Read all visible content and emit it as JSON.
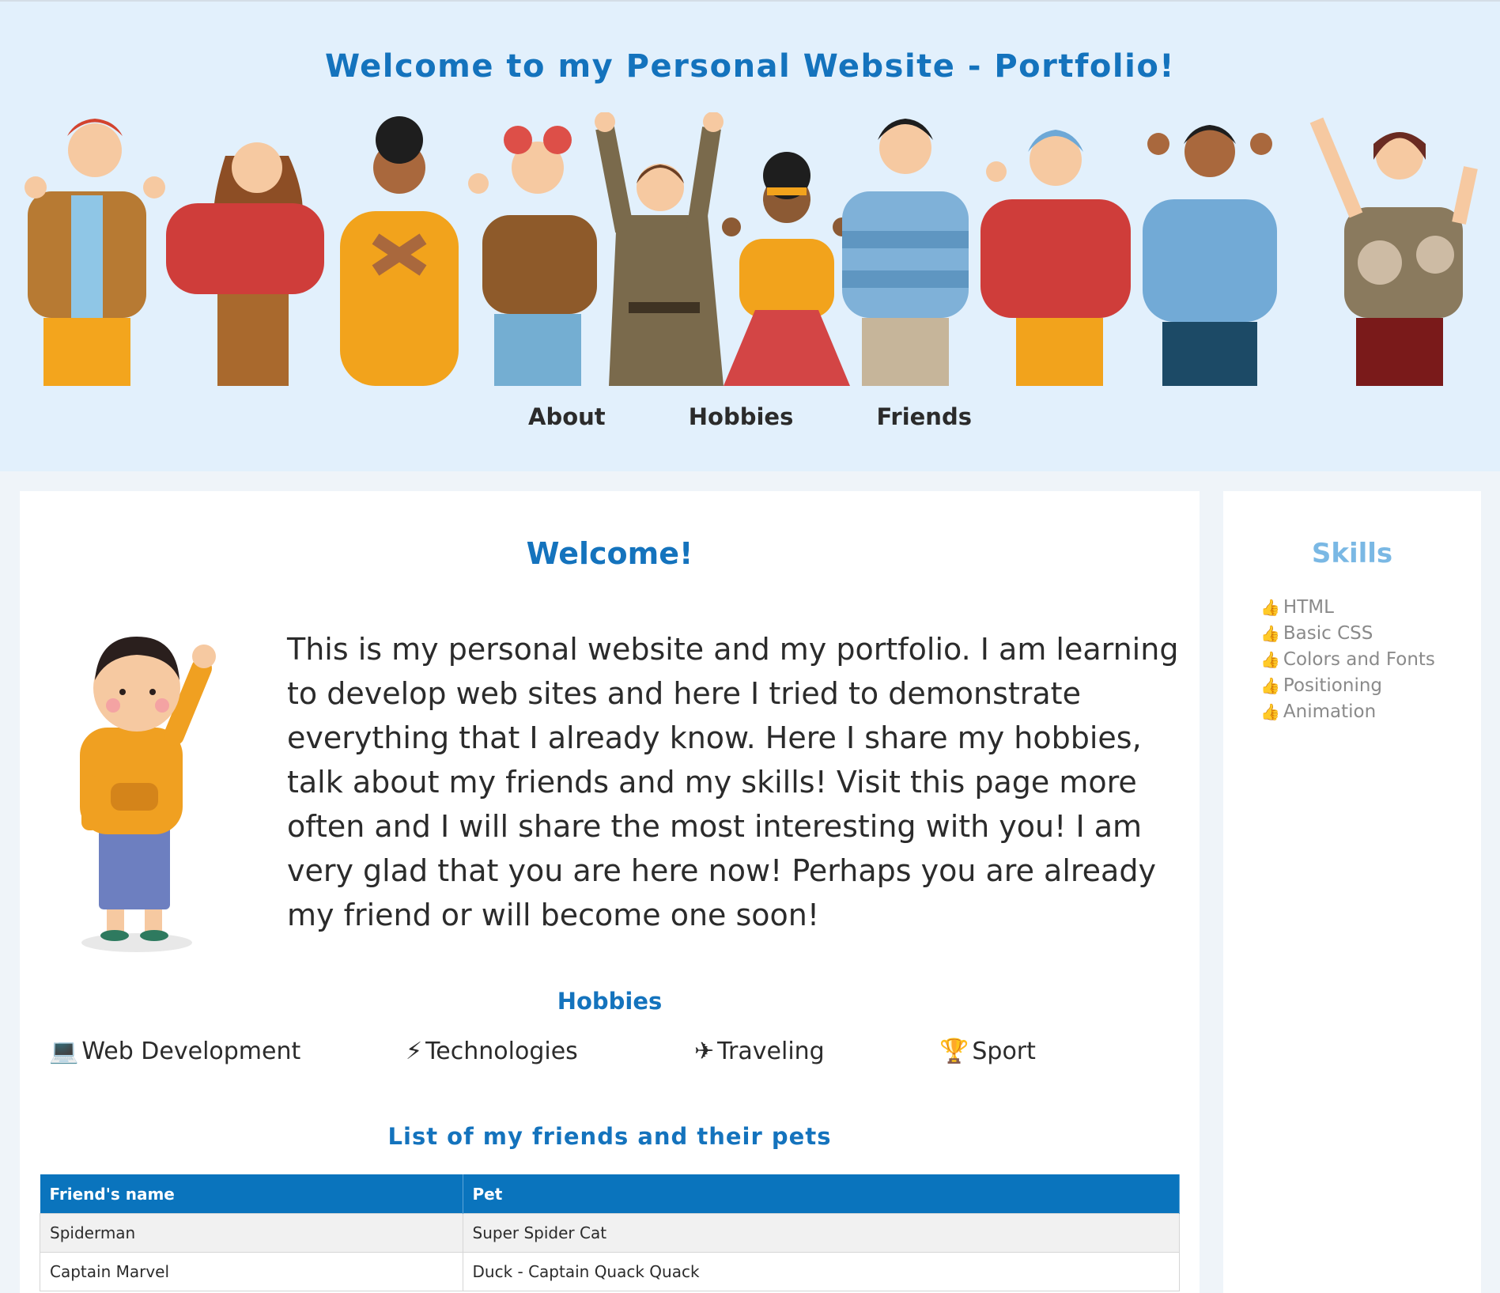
{
  "header": {
    "title": "Welcome to my Personal Website - Portfolio!",
    "nav": [
      "About",
      "Hobbies",
      "Friends"
    ]
  },
  "main": {
    "welcome_title": "Welcome!",
    "intro": "This is my personal website and my portfolio. I am learning to develop web sites and here I tried to demonstrate everything that I already know. Here I share my hobbies, talk about my friends and my skills! Visit this page more often and I will share the most interesting with you! I am very glad that you are here now! Perhaps you are already my friend or will become one soon!",
    "hobbies_title": "Hobbies",
    "hobbies": [
      {
        "icon": "💻",
        "label": "Web Development"
      },
      {
        "icon": "⚡",
        "label": "Technologies"
      },
      {
        "icon": "✈",
        "label": "Traveling"
      },
      {
        "icon": "🏆",
        "label": "Sport"
      }
    ],
    "friends_title": "List of my friends and their pets",
    "friends_table": {
      "headers": [
        "Friend's name",
        "Pet"
      ],
      "rows": [
        [
          "Spiderman",
          "Super Spider Cat"
        ],
        [
          "Captain Marvel",
          "Duck - Captain Quack Quack"
        ]
      ]
    }
  },
  "sidebar": {
    "skills_title": "Skills",
    "skill_icon": "👍",
    "skills": [
      "HTML",
      "Basic CSS",
      "Colors and Fonts",
      "Positioning",
      "Animation"
    ]
  },
  "colors": {
    "accent": "#1473bd",
    "header_bg": "#e2f0fc",
    "table_header": "#0a74bd",
    "skills_title": "#7ab8e4"
  }
}
